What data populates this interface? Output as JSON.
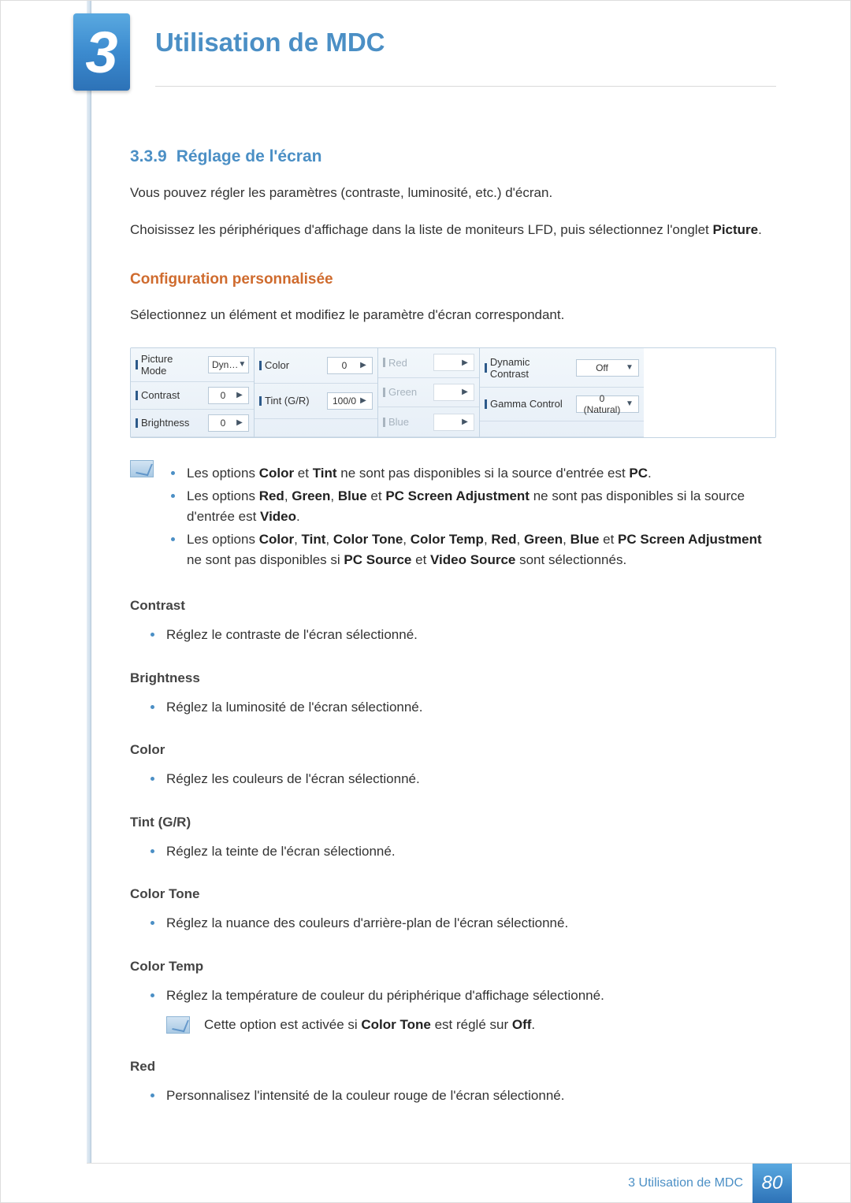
{
  "chapter": {
    "number": "3",
    "title": "Utilisation de MDC"
  },
  "section": {
    "number": "3.3.9",
    "title": "Réglage de l'écran"
  },
  "intro": {
    "p1": "Vous pouvez régler les paramètres (contraste, luminosité, etc.) d'écran.",
    "p2a": "Choisissez les périphériques d'affichage dans la liste de moniteurs LFD, puis sélectionnez l'onglet ",
    "p2b": "Picture",
    "p2c": "."
  },
  "custom": {
    "heading": "Configuration personnalisée",
    "desc": "Sélectionnez un élément et modifiez le paramètre d'écran correspondant."
  },
  "panel": {
    "picture_mode": {
      "label": "Picture Mode",
      "value": "Dyn…"
    },
    "contrast": {
      "label": "Contrast",
      "value": "0"
    },
    "brightness": {
      "label": "Brightness",
      "value": "0"
    },
    "color": {
      "label": "Color",
      "value": "0"
    },
    "tint": {
      "label": "Tint (G/R)",
      "value": "100/0"
    },
    "red": {
      "label": "Red",
      "value": ""
    },
    "green": {
      "label": "Green",
      "value": ""
    },
    "blue": {
      "label": "Blue",
      "value": ""
    },
    "dyn_contrast": {
      "label": "Dynamic Contrast",
      "value": "Off"
    },
    "gamma": {
      "label": "Gamma Control",
      "value": "0 (Natural)"
    }
  },
  "notes": {
    "n1a": "Les options ",
    "n1b": "Color",
    "n1c": " et ",
    "n1d": "Tint",
    "n1e": " ne sont pas disponibles si la source d'entrée est ",
    "n1f": "PC",
    "n1g": ".",
    "n2a": "Les options ",
    "n2b": "Red",
    "n2c": ", ",
    "n2d": "Green",
    "n2e": ", ",
    "n2f": "Blue",
    "n2g": " et ",
    "n2h": "PC Screen Adjustment",
    "n2i": " ne sont pas disponibles si la source d'entrée est ",
    "n2j": "Video",
    "n2k": ".",
    "n3a": "Les options ",
    "n3b": "Color",
    "n3c": ", ",
    "n3d": "Tint",
    "n3e": ", ",
    "n3f": "Color Tone",
    "n3g": ", ",
    "n3h": "Color Temp",
    "n3i": ", ",
    "n3j": "Red",
    "n3k": ", ",
    "n3l": "Green",
    "n3m": ", ",
    "n3n": "Blue",
    "n3o": " et ",
    "n3p": "PC Screen Adjustment",
    "n3q": " ne sont pas disponibles si ",
    "n3r": "PC Source",
    "n3s": " et ",
    "n3t": "Video Source",
    "n3u": " sont sélectionnés."
  },
  "params": {
    "contrast": {
      "title": "Contrast",
      "desc": "Réglez le contraste de l'écran sélectionné."
    },
    "brightness": {
      "title": "Brightness",
      "desc": "Réglez la luminosité de l'écran sélectionné."
    },
    "color": {
      "title": "Color",
      "desc": "Réglez les couleurs de l'écran sélectionné."
    },
    "tint": {
      "title": "Tint (G/R)",
      "desc": "Réglez la teinte de l'écran sélectionné."
    },
    "color_tone": {
      "title": "Color Tone",
      "desc": "Réglez la nuance des couleurs d'arrière-plan de l'écran sélectionné."
    },
    "color_temp": {
      "title": "Color Temp",
      "desc": "Réglez la température de couleur du périphérique d'affichage sélectionné.",
      "note_a": "Cette option est activée si ",
      "note_b": "Color Tone",
      "note_c": " est réglé sur ",
      "note_d": "Off",
      "note_e": "."
    },
    "red": {
      "title": "Red",
      "desc": "Personnalisez l'intensité de la couleur rouge de l'écran sélectionné."
    }
  },
  "footer": {
    "label": "3 Utilisation de MDC",
    "page": "80"
  },
  "glyphs": {
    "down": "▼",
    "right": "▶"
  }
}
